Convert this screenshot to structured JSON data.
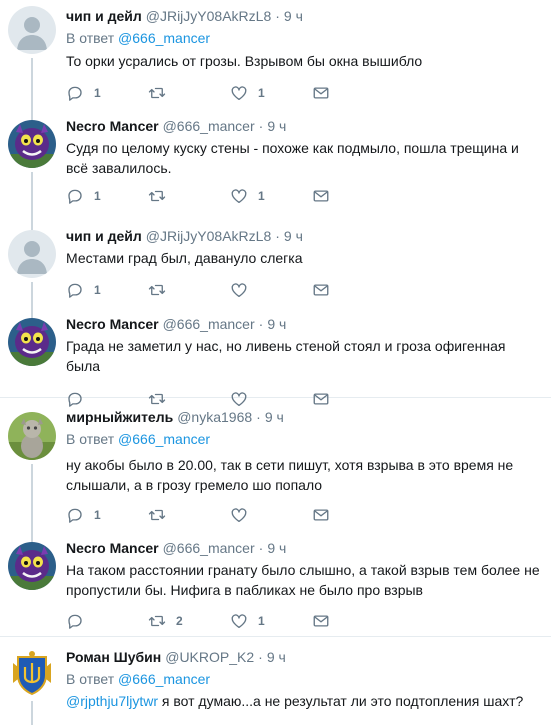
{
  "tweets": [
    {
      "name": "чип и дейл",
      "handle": "@JRijJyY08AkRzL8",
      "sep": "·",
      "time": "9 ч",
      "reply_prefix": "В ответ",
      "reply_to": "@666_mancer",
      "text": "То орки усрались от грозы. Взрывом бы окна вышибло",
      "replies": "1",
      "retweets": "",
      "likes": "1",
      "avatar": "default-avatar"
    },
    {
      "name": "Necro Mancer",
      "handle": "@666_mancer",
      "sep": "·",
      "time": "9 ч",
      "text": "Судя по целому куску стены - похоже как подмыло, пошла трещина и всё завалилось.",
      "replies": "1",
      "retweets": "",
      "likes": "1",
      "avatar": "purple-creature-avatar"
    },
    {
      "name": "чип и дейл",
      "handle": "@JRijJyY08AkRzL8",
      "sep": "·",
      "time": "9 ч",
      "text": "Местами град был, давануло слегка",
      "replies": "1",
      "retweets": "",
      "likes": "",
      "avatar": "default-avatar"
    },
    {
      "name": "Necro Mancer",
      "handle": "@666_mancer",
      "sep": "·",
      "time": "9 ч",
      "text": "Града не заметил у нас, но ливень стеной стоял и гроза офигенная была",
      "replies": "",
      "retweets": "",
      "likes": "",
      "avatar": "purple-creature-avatar"
    },
    {
      "name": "мирныйжитель",
      "handle": "@nyka1968",
      "sep": "·",
      "time": "9 ч",
      "reply_prefix": "В ответ",
      "reply_to": "@666_mancer",
      "text": "ну акобы было в 20.00, так в сети пишут, хотя взрыва в это время не слышали, а в грозу гремело шо попало",
      "replies": "1",
      "retweets": "",
      "likes": "",
      "avatar": "figurine-avatar"
    },
    {
      "name": "Necro Mancer",
      "handle": "@666_mancer",
      "sep": "·",
      "time": "9 ч",
      "text": "На таком расстоянии гранату было слышно, а такой взрыв тем более не пропустили бы. Нифига в пабликах не было про взрыв",
      "replies": "",
      "retweets": "2",
      "likes": "1",
      "avatar": "purple-creature-avatar"
    },
    {
      "name": "Роман Шубин",
      "handle": "@UKROP_K2",
      "sep": "·",
      "time": "9 ч",
      "reply_prefix": "В ответ",
      "reply_to": "@666_mancer",
      "mention": "@rjpthju7ljytwr",
      "text": " я вот думаю...а не результат ли это подтопления шахт?",
      "avatar": "coat-of-arms-avatar"
    }
  ],
  "icons": {
    "reply": "reply-icon",
    "retweet": "retweet-icon",
    "like": "heart-icon",
    "dm": "envelope-icon"
  },
  "colors": {
    "link": "#1b95e0",
    "muted": "#657786",
    "thread_line": "#ccd6dd"
  }
}
